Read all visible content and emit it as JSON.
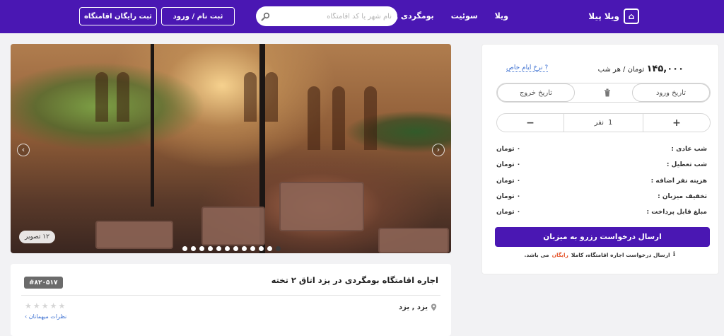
{
  "header": {
    "logo_text": "ویلا پیلا",
    "nav": [
      "ویلا",
      "سوئیت",
      "بومگردی و خانه سنتی"
    ],
    "search_placeholder": "نام شهر یا کد اقامتگاه",
    "login_label": "ثبت نام / ورود",
    "register_property_label": "ثبت رایگان اقامتگاه",
    "accent_color": "#4a17b3"
  },
  "gallery": {
    "photo_count": "۱۲ تصویر",
    "slide_count": 12,
    "active_slide": 12,
    "prev_icon": "chevron-left-icon",
    "next_icon": "chevron-right-icon"
  },
  "listing": {
    "title": "اجاره اقامتگاه بومگردی در یزد اتاق ۲ تخته",
    "code": "#۸۲۰۵۱۷",
    "location": "یزد , یزد",
    "rating_stars": 5,
    "reviews_link": "نظرات میهمانان",
    "reviews_chevron": "›"
  },
  "booking": {
    "price": "۱۴۵,۰۰۰",
    "price_unit": "تومان / هر شب",
    "special_days_link": "نرخ ایام خاص",
    "special_days_mark": "?",
    "checkin_label": "تاریخ ورود",
    "checkout_label": "تاریخ خروج",
    "plus": "+",
    "minus": "−",
    "guest_count": "1",
    "guest_unit": "نفر",
    "costs": [
      {
        "label": "شب عادی :",
        "value": "۰ تومان"
      },
      {
        "label": "شب تعطیل :",
        "value": "۰ تومان"
      },
      {
        "label": "هزینه نفر اضافه :",
        "value": "۰ تومان"
      },
      {
        "label": "تخفیف میزبان :",
        "value": "۰ تومان"
      },
      {
        "label": "مبلغ قابل پرداخت :",
        "value": "۰ تومان"
      }
    ],
    "submit_label": "ارسال درخواست رزرو به میزبان",
    "note_prefix": "ارسال درخواست اجاره اقامتگاه، کاملا",
    "note_free": "رایگان",
    "note_suffix": "می باشد.",
    "note_icon": "ℹ"
  }
}
